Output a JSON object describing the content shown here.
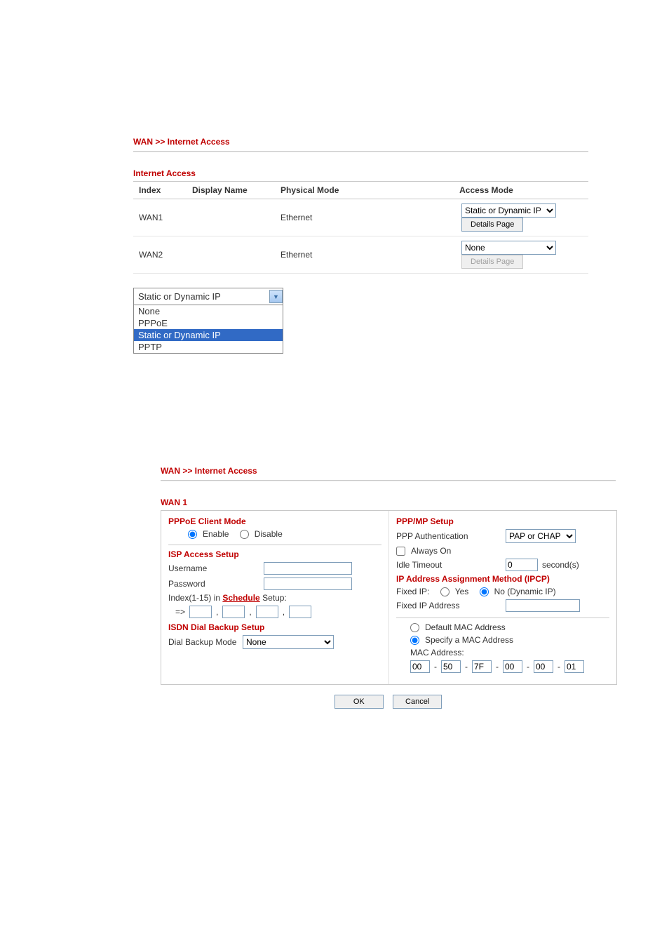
{
  "breadcrumb": "WAN >> Internet Access",
  "internet_access": {
    "title": "Internet Access",
    "headers": {
      "index": "Index",
      "display_name": "Display Name",
      "physical_mode": "Physical Mode",
      "access_mode": "Access Mode"
    },
    "rows": [
      {
        "index": "WAN1",
        "display_name": "",
        "physical_mode": "Ethernet",
        "access_mode": "Static or Dynamic IP",
        "details": "Details Page",
        "details_enabled": true
      },
      {
        "index": "WAN2",
        "display_name": "",
        "physical_mode": "Ethernet",
        "access_mode": "None",
        "details": "Details Page",
        "details_enabled": false
      }
    ]
  },
  "dropdown": {
    "selected": "Static or Dynamic IP",
    "options": [
      "None",
      "PPPoE",
      "Static or Dynamic IP",
      "PPTP"
    ]
  },
  "breadcrumb2": "WAN >> Internet Access",
  "wan1": {
    "title": "WAN 1",
    "pppoe": {
      "title": "PPPoE Client Mode",
      "enable": "Enable",
      "disable": "Disable"
    },
    "isp": {
      "title": "ISP Access Setup",
      "username": "Username",
      "password": "Password",
      "schedule_pre": "Index(1-15) in ",
      "schedule_link": "Schedule",
      "schedule_post": " Setup:",
      "arrow": "=>"
    },
    "isdn": {
      "title": "ISDN Dial Backup Setup",
      "mode_label": "Dial Backup Mode",
      "mode_value": "None"
    },
    "ppp": {
      "title": "PPP/MP Setup",
      "auth_label": "PPP Authentication",
      "auth_value": "PAP or CHAP",
      "always_on": "Always On",
      "idle_label": "Idle Timeout",
      "idle_value": "0",
      "seconds": "second(s)",
      "ipcp_title": "IP Address Assignment Method (IPCP)",
      "fixed_ip_label": "Fixed IP:",
      "yes": "Yes",
      "no": "No (Dynamic IP)",
      "fixed_addr_label": "Fixed IP Address"
    },
    "mac": {
      "default": "Default MAC Address",
      "specify": "Specify a MAC Address",
      "label": "MAC Address:",
      "o1": "00",
      "o2": "50",
      "o3": "7F",
      "o4": "00",
      "o5": "00",
      "o6": "01"
    },
    "buttons": {
      "ok": "OK",
      "cancel": "Cancel"
    }
  }
}
